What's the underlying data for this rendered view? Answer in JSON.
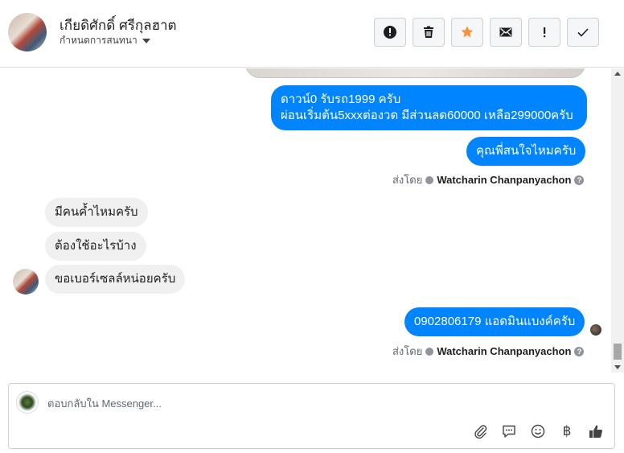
{
  "header": {
    "name": "เกียดิศักดิ์ ศรีกุลฮาต",
    "assign_label": "กำหนดการสนทนา",
    "actions": [
      {
        "icon": "alert-circle-icon"
      },
      {
        "icon": "trash-icon"
      },
      {
        "icon": "star-icon"
      },
      {
        "icon": "envelope-icon"
      },
      {
        "icon": "exclamation-icon"
      },
      {
        "icon": "checkmark-icon"
      }
    ],
    "star_color": "#f7923b"
  },
  "messages": {
    "out1_line1": "ดาวน์0 รับรถ1999 ครับ",
    "out1_line2": "ผ่อนเริ่มต้น5xxxต่องวด มีส่วนลด60000 เหลือ299000ครับ",
    "out2": "คุณพี่สนใจไหมครับ",
    "sent_by_1_prefix": "ส่งโดย",
    "sent_by_1_name": "Watcharin Chanpanyachon",
    "in1": "มีคนค้ำไหมครับ",
    "in2": "ต้องใช้อะไรบ้าง",
    "in3": "ขอเบอร์เซลล์หน่อยครับ",
    "out3": "0902806179 แอดมินแบงค์ครับ",
    "sent_by_2_prefix": "ส่งโดย",
    "sent_by_2_name": "Watcharin Chanpanyachon"
  },
  "composer": {
    "placeholder": "ตอบกลับใน Messenger...",
    "tools": [
      "paperclip-icon",
      "chat-bubble-icon",
      "smiley-icon",
      "baht-icon",
      "thumbs-up-icon"
    ],
    "baht_symbol": "฿"
  },
  "colors": {
    "outgoing_bubble": "#0084ff",
    "incoming_bubble": "#f1f0f0"
  }
}
